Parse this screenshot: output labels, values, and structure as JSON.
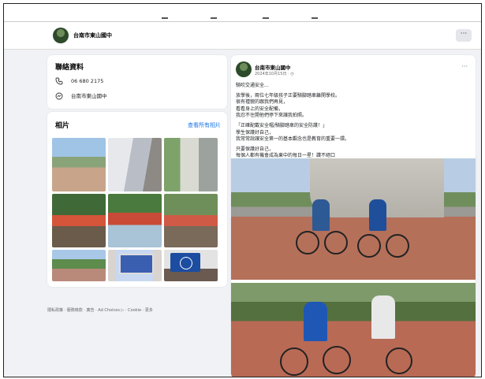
{
  "page": {
    "name": "台南市東山國中",
    "more_label": "···"
  },
  "contact": {
    "title": "聯絡資料",
    "phone": "06 680 2175",
    "messenger": "台南市東山國中"
  },
  "photos": {
    "title": "相片",
    "see_all": "查看所有相片"
  },
  "footer": "隱私政策 · 服務條款 · 廣告 · Ad Choices ▷ · Cookie · 更多",
  "post": {
    "author": "台南市東山國中",
    "date": "2024年10月15日 · ◷",
    "more": "···",
    "lines": [
      "騎吹交通安全...",
      "",
      "放學後，兩位七年級孩子正要騎腳踏車離開學校。",
      "很有禮貌的跟我們再見，",
      "看看身上的安全配備，",
      "我忍不住開他們停下來讓我拍照。",
      "",
      "「正確配戴安全帽/騎腳踏車的安全防護！」",
      "學生保護好自己，",
      "我常常說讓安全第一的基本觀念也是教育的重要一環。",
      "",
      "只要保護好自己，",
      "每個人都有機會成為東中的每日一星！讚不絕口"
    ]
  },
  "icons": {
    "phone": "phone-icon",
    "messenger": "messenger-icon"
  }
}
